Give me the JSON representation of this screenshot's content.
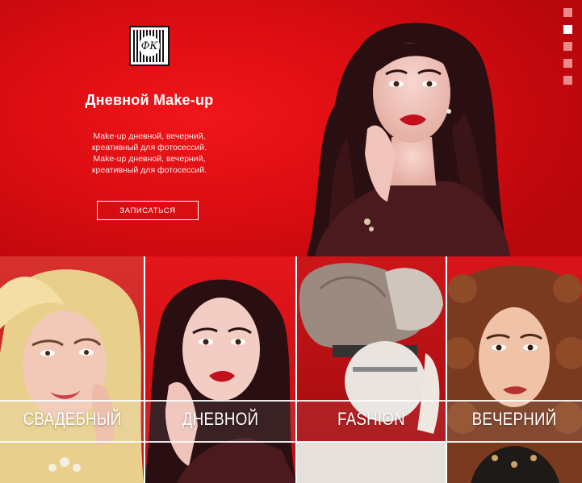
{
  "hero": {
    "logo_monogram": "ФК",
    "title": "Дневной Make-up",
    "description": "Make-up дневной, вечерний, креативный для фотосессий. Make-up дневной, вечерний, креативный для фотосессий.",
    "cta_label": "ЗАПИСАТЬСЯ"
  },
  "pager": {
    "active_index": 1,
    "count": 5
  },
  "categories": [
    {
      "label": "СВАДЕБНЫЙ"
    },
    {
      "label": "ДНЕВНОЙ"
    },
    {
      "label": "FASHION"
    },
    {
      "label": "ВЕЧЕРНИЙ"
    }
  ],
  "colors": {
    "brand_red": "#dc0d12",
    "text_light": "#ffffff"
  }
}
